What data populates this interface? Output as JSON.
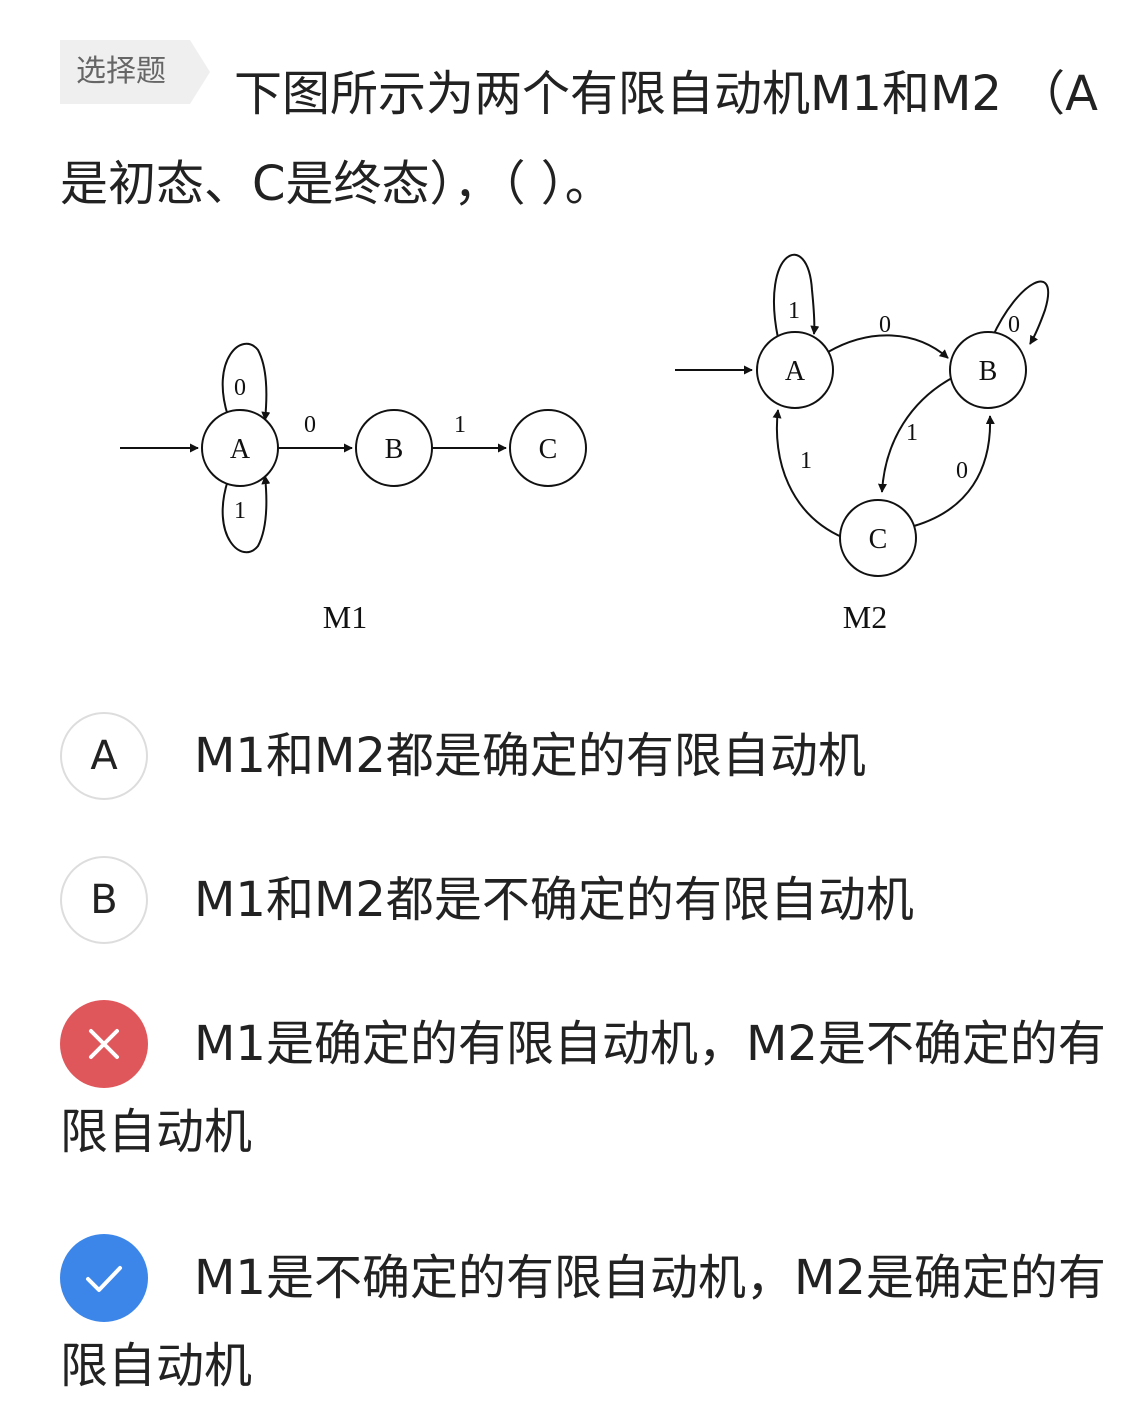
{
  "question": {
    "tag": "选择题",
    "text": "下图所示为两个有限自动机M1和M2 （A是初态、C是终态），（ ）。"
  },
  "figure": {
    "m1": {
      "caption": "M1",
      "states": [
        "A",
        "B",
        "C"
      ],
      "transitions": [
        {
          "from": "A",
          "to": "A",
          "label": "0"
        },
        {
          "from": "A",
          "to": "A",
          "label": "1"
        },
        {
          "from": "A",
          "to": "B",
          "label": "0"
        },
        {
          "from": "B",
          "to": "C",
          "label": "1"
        }
      ]
    },
    "m2": {
      "caption": "M2",
      "states": [
        "A",
        "B",
        "C"
      ],
      "transitions": [
        {
          "from": "A",
          "to": "A",
          "label": "1"
        },
        {
          "from": "A",
          "to": "B",
          "label": "0"
        },
        {
          "from": "B",
          "to": "B",
          "label": "0"
        },
        {
          "from": "B",
          "to": "C",
          "label": "1"
        },
        {
          "from": "C",
          "to": "A",
          "label": "1"
        },
        {
          "from": "C",
          "to": "B",
          "label": "0"
        }
      ]
    }
  },
  "options": [
    {
      "badge": "A",
      "status": "unselected",
      "text": "M1和M2都是确定的有限自动机"
    },
    {
      "badge": "B",
      "status": "unselected",
      "text": "M1和M2都是不确定的有限自动机"
    },
    {
      "badge": "",
      "status": "wrong",
      "icon": "close-icon",
      "color": "#e0575b",
      "text": "M1是确定的有限自动机，M2是不确定的有限自动机"
    },
    {
      "badge": "",
      "status": "correct",
      "icon": "check-icon",
      "color": "#3c86ea",
      "text": "M1是不确定的有限自动机，M2是确定的有限自动机"
    }
  ]
}
